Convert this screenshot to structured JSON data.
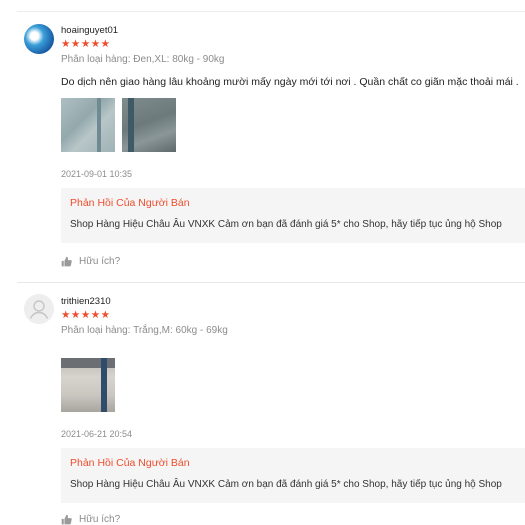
{
  "reviews": [
    {
      "username": "hoainguyet01",
      "rating": "★★★★★",
      "variation": "Phân loại hàng: Đen,XL: 80kg - 90kg",
      "comment": "Do dịch nên giao hàng lâu khoảng mười mấy ngày mới tới nơi . Quần chất co giãn  mặc thoải mái .",
      "timestamp": "2021-09-01 10:35",
      "reply_title": "Phản Hồi Của Người Bán",
      "reply_text": "Shop Hàng Hiệu Châu Âu VNXK Cảm ơn bạn đã đánh giá 5* cho Shop, hãy tiếp tục ủng hộ Shop",
      "helpful_label": "Hữu ích?"
    },
    {
      "username": "trithien2310",
      "rating": "★★★★★",
      "variation": "Phân loại hàng: Trắng,M: 60kg - 69kg",
      "timestamp": "2021-06-21 20:54",
      "reply_title": "Phản Hồi Của Người Bán",
      "reply_text": "Shop Hàng Hiệu Châu Âu VNXK Cảm ơn bạn đã đánh giá 5* cho Shop, hãy tiếp tục ủng hộ Shop",
      "helpful_label": "Hữu ích?"
    }
  ],
  "colors": {
    "accent": "#ee4d2d",
    "muted_text": "#8c8c8c",
    "reply_background": "#f5f5f5"
  }
}
